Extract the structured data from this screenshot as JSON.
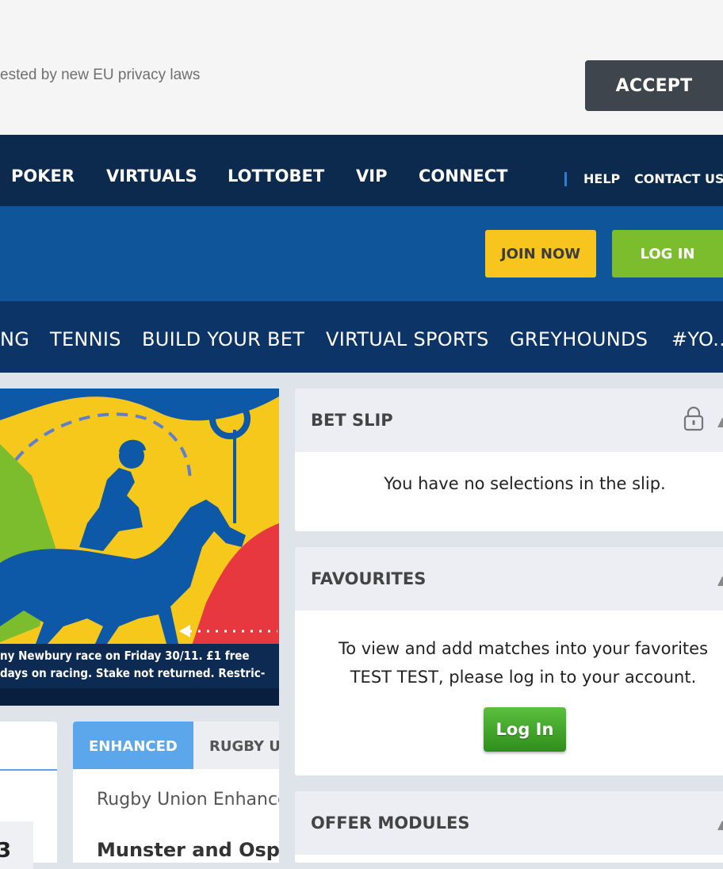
{
  "cookie": {
    "text": "ested by new EU privacy laws",
    "accept_label": "ACCEPT"
  },
  "top_nav": {
    "items": [
      "POKER",
      "VIRTUALS",
      "LOTTOBET",
      "VIP",
      "CONNECT"
    ],
    "help": "HELP",
    "contact": "CONTACT US"
  },
  "header": {
    "join_label": "JOIN NOW",
    "login_label": "LOG IN"
  },
  "sport_nav": {
    "items": [
      "NG",
      "TENNIS",
      "BUILD YOUR BET",
      "VIRTUAL SPORTS",
      "GREYHOUNDS",
      "#YO..."
    ]
  },
  "banner": {
    "caption_line1": "ny Newbury race on Friday 30/11. £1 free",
    "caption_line2": "days on racing. Stake not returned. Restric-"
  },
  "left_card": {
    "number": "3"
  },
  "enhanced_card": {
    "tab_enhanced": "ENHANCED",
    "tab_rugby": "RUGBY U",
    "subtitle": "Rugby Union Enhance",
    "match": "Munster and Osprey"
  },
  "bet_slip": {
    "title": "BET SLIP",
    "message": "You have no selections in the slip."
  },
  "favourites": {
    "title": "FAVOURITES",
    "message_line1": "To view and add matches into your favorites",
    "message_line2": "TEST TEST, please log in to your account.",
    "login_label": "Log In"
  },
  "offer_modules": {
    "title": "OFFER MODULES"
  },
  "colors": {
    "top_nav_bg": "#0b2a4e",
    "header_bg": "#0e5599",
    "sport_nav_bg": "#0c3466",
    "join_button": "#f8c51e",
    "login_button": "#7cbd2e",
    "accent_blue": "#5ca6ec"
  }
}
